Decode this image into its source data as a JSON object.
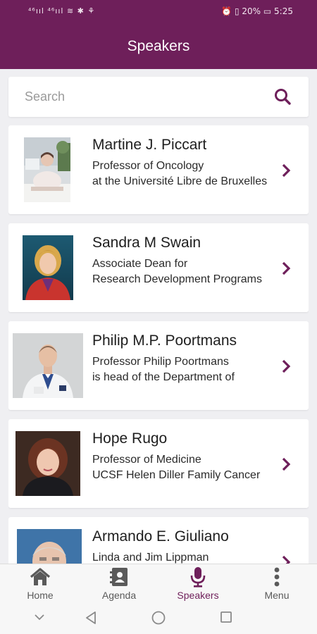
{
  "status": {
    "left": "⁴⁶ııl ⁴⁶ııl ≋ ✱ ⚘",
    "right": "⏰ ▯ 20% ▭ 5:25"
  },
  "header": {
    "title": "Speakers"
  },
  "search": {
    "placeholder": "Search",
    "value": ""
  },
  "speakers": [
    {
      "name": "Martine J. Piccart",
      "line1": "Professor of Oncology",
      "line2": "at the Université Libre de Bruxelles"
    },
    {
      "name": "Sandra M Swain",
      "line1": "Associate Dean for",
      "line2": "Research Development Programs"
    },
    {
      "name": "Philip M.P. Poortmans",
      "line1": "Professor Philip Poortmans",
      "line2": "is head of the Department of"
    },
    {
      "name": "Hope Rugo",
      "line1": "Professor of Medicine",
      "line2": "UCSF Helen Diller Family Cancer"
    },
    {
      "name": "Armando E. Giuliano",
      "line1": "Linda and Jim Lippman",
      "line2": ""
    }
  ],
  "tabs": [
    {
      "label": "Home",
      "icon": "home-icon"
    },
    {
      "label": "Agenda",
      "icon": "agenda-icon"
    },
    {
      "label": "Speakers",
      "icon": "microphone-icon"
    },
    {
      "label": "Menu",
      "icon": "more-vertical-icon"
    }
  ],
  "colors": {
    "brand": "#6e1f5a",
    "tab_inactive": "#5a5a5a",
    "background": "#efeff2"
  }
}
